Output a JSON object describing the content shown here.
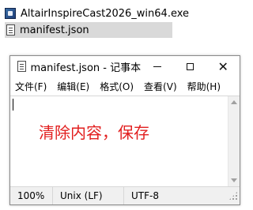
{
  "explorer": {
    "exe_filename": "AltairInspireCast2026_win64.exe",
    "json_filename": "manifest.json",
    "icons": [
      "installer-icon",
      "document-icon"
    ]
  },
  "window": {
    "title": "manifest.json - 记事本",
    "controls": {
      "minimize": "minimize-icon",
      "maximize": "maximize-icon",
      "close": "✕"
    }
  },
  "menu": [
    {
      "label": "文件(F)"
    },
    {
      "label": "编辑(E)"
    },
    {
      "label": "格式(O)"
    },
    {
      "label": "查看(V)"
    },
    {
      "label": "帮助(H)"
    }
  ],
  "editor": {
    "content": "",
    "annotation": "清除内容，保存",
    "annotation_color": "#e21f1f"
  },
  "status": {
    "zoom": "100%",
    "eol": "Unix (LF)",
    "encoding": "UTF-8"
  }
}
